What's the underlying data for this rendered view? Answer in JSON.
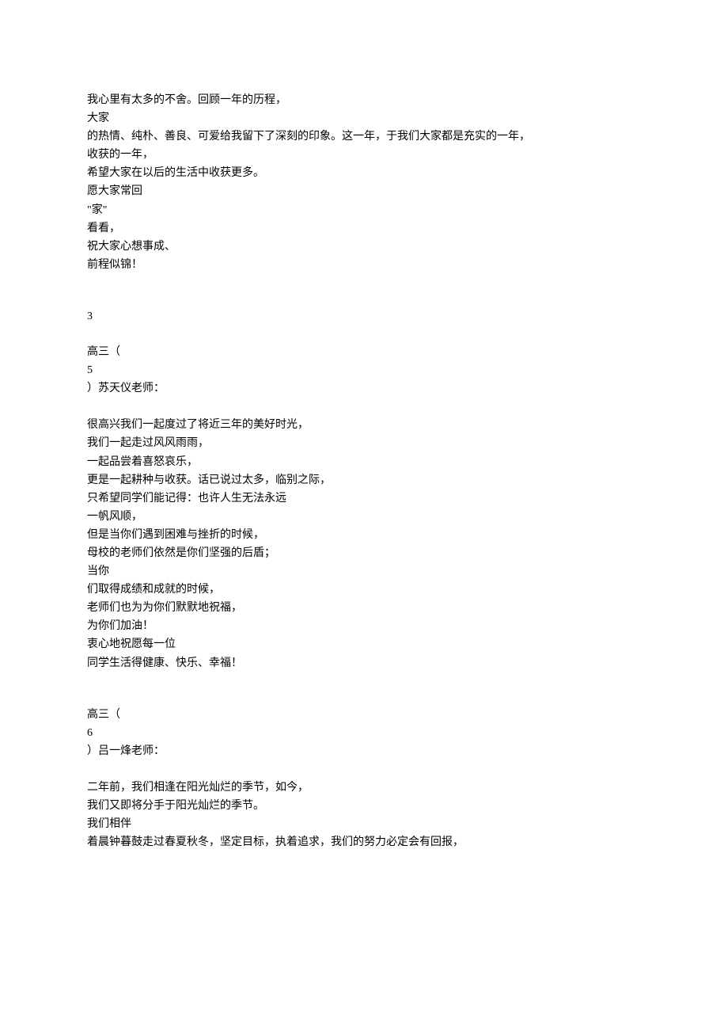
{
  "block1": {
    "l1": "我心里有太多的不舍。回顾一年的历程，",
    "l2": "大家",
    "l3": "的热情、纯朴、善良、可爱给我留下了深刻的印象。这一年，于我们大家都是充实的一年，",
    "l4": "收获的一年，",
    "l5": "希望大家在以后的生活中收获更多。",
    "l6": "愿大家常回",
    "l7": "\"家\"",
    "l8": "看看，",
    "l9": "祝大家心想事成、",
    "l10": "前程似锦！"
  },
  "page_number": "3",
  "block2_header": {
    "l1": "高三（",
    "l2": "5",
    "l3": "）苏天仪老师："
  },
  "block2": {
    "l1": "很高兴我们一起度过了将近三年的美好时光，",
    "l2": "我们一起走过风风雨雨，",
    "l3": "一起品尝着喜怒哀乐，",
    "l4": "更是一起耕种与收获。话已说过太多，临别之际，",
    "l5": "只希望同学们能记得：也许人生无法永远",
    "l6": "一帆风顺，",
    "l7": "但是当你们遇到困难与挫折的时候，",
    "l8": "母校的老师们依然是你们坚强的后盾；",
    "l9": "当你",
    "l10": "们取得成绩和成就的时候，",
    "l11": "老师们也为为你们默默地祝福，",
    "l12": "为你们加油！",
    "l13": "衷心地祝愿每一位",
    "l14": "同学生活得健康、快乐、幸福！"
  },
  "block3_header": {
    "l1": "高三（",
    "l2": "6",
    "l3": "）吕一烽老师："
  },
  "block3": {
    "l1": "二年前，我们相逢在阳光灿烂的季节，如今，",
    "l2": "我们又即将分手于阳光灿烂的季节。",
    "l3": "我们相伴",
    "l4": "着晨钟暮鼓走过春夏秋冬，坚定目标，执着追求，我们的努力必定会有回报，"
  }
}
